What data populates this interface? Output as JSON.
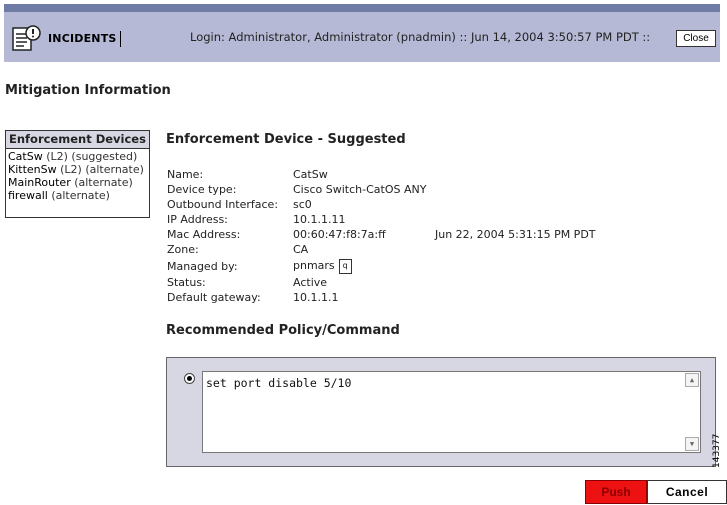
{
  "header": {
    "section": "INCIDENTS",
    "login_info": "Login: Administrator, Administrator (pnadmin)  ::  Jun 14, 2004 3:50:57 PM PDT  ::",
    "close_label": "Close"
  },
  "page_title": "Mitigation Information",
  "enforcement_devices": {
    "title": "Enforcement Devices",
    "items": [
      {
        "name": "CatSw",
        "role": "(L2) (suggested)"
      },
      {
        "name": "KittenSw",
        "role": "(L2) (alternate)"
      },
      {
        "name": "MainRouter",
        "role": "(alternate)"
      },
      {
        "name": "firewall",
        "role": "(alternate)"
      }
    ]
  },
  "device_details": {
    "title": "Enforcement Device - Suggested",
    "name_label": "Name:",
    "name": "CatSw",
    "type_label": "Device type:",
    "type": "Cisco Switch-CatOS ANY",
    "outbound_label": "Outbound Interface:",
    "outbound": "sc0",
    "ip_label": "IP Address:",
    "ip": "10.1.1.11",
    "mac_label": "Mac Address:",
    "mac": "00:60:47:f8:7a:ff",
    "mac_time": "Jun 22, 2004 5:31:15 PM PDT",
    "zone_label": "Zone:",
    "zone": "CA",
    "managed_label": "Managed by:",
    "managed": "pnmars",
    "status_label": "Status:",
    "status": "Active",
    "gateway_label": "Default gateway:",
    "gateway": "10.1.1.1"
  },
  "policy": {
    "title": "Recommended Policy/Command",
    "command": "set port disable 5/10"
  },
  "buttons": {
    "push": "Push",
    "cancel": "Cancel"
  },
  "figure_id": "143377",
  "icons": {
    "incidents": "incidents-document-icon",
    "query": "magnifier-icon"
  }
}
